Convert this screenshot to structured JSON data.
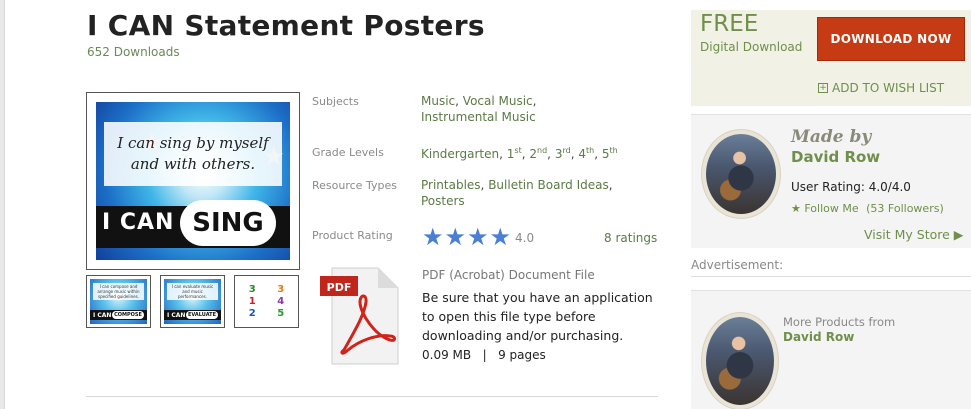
{
  "product": {
    "title": "I CAN Statement Posters",
    "downloads": "652 Downloads"
  },
  "preview": {
    "poster_line1": "I can sing by myself",
    "poster_line2": "and with others.",
    "poster_ican": "I CAN",
    "poster_word": "SING",
    "thumbs": [
      {
        "word": "COMPOSE",
        "text": "I can compose and arrange music within specified guidelines."
      },
      {
        "word": "EVALUATE",
        "text": "I can evaluate music and music performances."
      },
      {
        "numbers": [
          "3",
          "3",
          "1",
          "4",
          "2",
          "5"
        ]
      }
    ],
    "thumb_ican": "I CAN"
  },
  "details": {
    "subjects_label": "Subjects",
    "subjects": [
      "Music",
      "Vocal Music",
      "Instrumental Music"
    ],
    "grade_label": "Grade Levels",
    "grades": {
      "kindergarten": "Kindergarten",
      "g1": "1",
      "g1_suffix": "st",
      "g2": "2",
      "g2_suffix": "nd",
      "g3": "3",
      "g3_suffix": "rd",
      "g4": "4",
      "g4_suffix": "th",
      "g5": "5",
      "g5_suffix": "th"
    },
    "resource_label": "Resource Types",
    "resources": [
      "Printables",
      "Bulletin Board Ideas",
      "Posters"
    ],
    "rating_label": "Product Rating",
    "rating_value": "4.0",
    "rating_stars": 4,
    "ratings_count": "8 ratings"
  },
  "file": {
    "icon_label": "PDF",
    "type": "PDF (Acrobat) Document File",
    "note": "Be sure that you have an application to open this file type before downloading and/or purchasing.",
    "size": "0.09 MB",
    "divider": "|",
    "pages": "9 pages"
  },
  "purchase": {
    "price": "FREE",
    "price_sub": "Digital Download",
    "download_label": "DOWNLOAD NOW",
    "wish_label": "ADD TO WISH LIST"
  },
  "seller": {
    "made_by": "Made by",
    "name": "David Row",
    "user_rating": "User Rating: 4.0/4.0",
    "follow": "Follow Me",
    "followers": "(53 Followers)",
    "visit": "Visit My Store ▶"
  },
  "ad": {
    "label": "Advertisement:",
    "more_from": "More Products from",
    "more_name": "David Row"
  },
  "colors": {
    "accent_green": "#6f8f4a",
    "download_button": "#c63a14",
    "star_blue": "#4a7fd4"
  }
}
